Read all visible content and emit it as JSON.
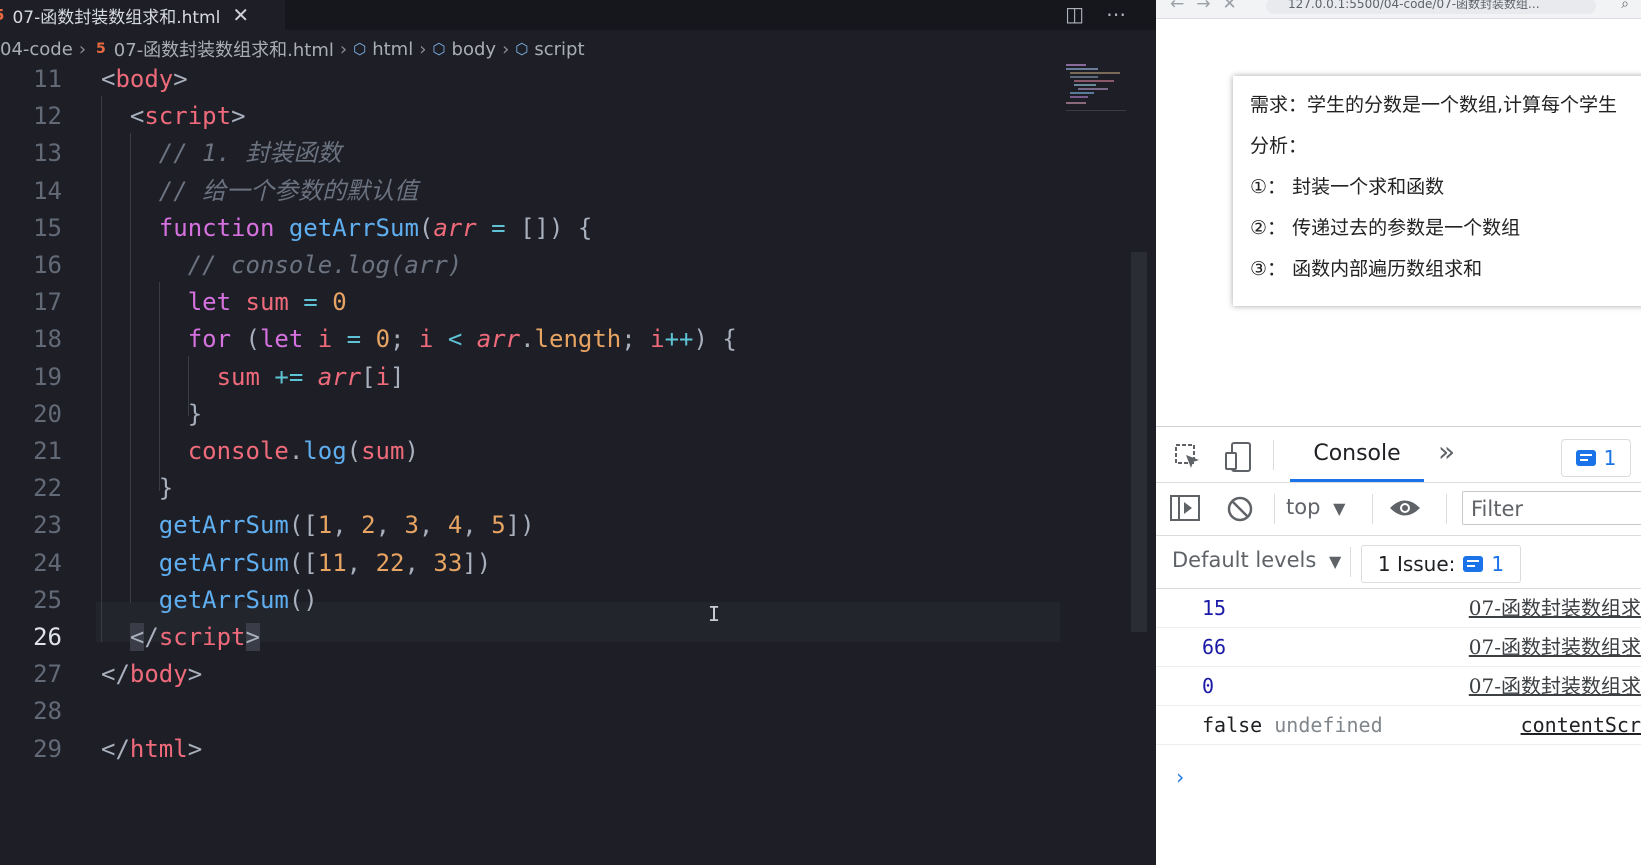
{
  "editor": {
    "tab_title": "07-函数封装数组求和.html",
    "tab_close": "✕",
    "breadcrumb": {
      "folder": "04-code",
      "file": "07-函数封装数组求和.html",
      "node1": "html",
      "node2": "body",
      "node3": "script"
    },
    "lines": [
      {
        "num": "11",
        "tokens": [
          [
            "p",
            "<"
          ],
          [
            "t",
            "body"
          ],
          [
            "p",
            ">"
          ]
        ]
      },
      {
        "num": "12",
        "tokens": [
          [
            "p",
            "  <"
          ],
          [
            "t",
            "script"
          ],
          [
            "p",
            ">"
          ]
        ]
      },
      {
        "num": "13",
        "tokens": [
          [
            "c",
            "    // 1. 封装函数"
          ]
        ]
      },
      {
        "num": "14",
        "tokens": [
          [
            "c",
            "    // 给一个参数的默认值"
          ]
        ]
      },
      {
        "num": "15",
        "tokens": [
          [
            "k",
            "    function "
          ],
          [
            "f",
            "getArrSum"
          ],
          [
            "p",
            "("
          ],
          [
            "it",
            "arr"
          ],
          [
            "o",
            " = "
          ],
          [
            "p",
            "[]) {"
          ]
        ]
      },
      {
        "num": "16",
        "tokens": [
          [
            "c",
            "      // console.log(arr)"
          ]
        ]
      },
      {
        "num": "17",
        "tokens": [
          [
            "k",
            "      let "
          ],
          [
            "v",
            "sum"
          ],
          [
            "o",
            " = "
          ],
          [
            "n",
            "0"
          ]
        ]
      },
      {
        "num": "18",
        "tokens": [
          [
            "k",
            "      for "
          ],
          [
            "p",
            "("
          ],
          [
            "k",
            "let "
          ],
          [
            "v",
            "i"
          ],
          [
            "o",
            " = "
          ],
          [
            "n",
            "0"
          ],
          [
            "p",
            "; "
          ],
          [
            "v",
            "i"
          ],
          [
            "o",
            " < "
          ],
          [
            "it",
            "arr"
          ],
          [
            "p",
            "."
          ],
          [
            "pr",
            "length"
          ],
          [
            "p",
            "; "
          ],
          [
            "v",
            "i"
          ],
          [
            "o",
            "++"
          ],
          [
            "p",
            ") {"
          ]
        ]
      },
      {
        "num": "19",
        "tokens": [
          [
            "v",
            "        sum"
          ],
          [
            "o",
            " += "
          ],
          [
            "it",
            "arr"
          ],
          [
            "p",
            "["
          ],
          [
            "v",
            "i"
          ],
          [
            "p",
            "]"
          ]
        ]
      },
      {
        "num": "20",
        "tokens": [
          [
            "p",
            "      }"
          ]
        ]
      },
      {
        "num": "21",
        "tokens": [
          [
            "v",
            "      console"
          ],
          [
            "p",
            "."
          ],
          [
            "f",
            "log"
          ],
          [
            "p",
            "("
          ],
          [
            "v",
            "sum"
          ],
          [
            "p",
            ")"
          ]
        ]
      },
      {
        "num": "22",
        "tokens": [
          [
            "p",
            "    }"
          ]
        ]
      },
      {
        "num": "23",
        "tokens": [
          [
            "f",
            "    getArrSum"
          ],
          [
            "p",
            "(["
          ],
          [
            "n",
            "1"
          ],
          [
            "p",
            ", "
          ],
          [
            "n",
            "2"
          ],
          [
            "p",
            ", "
          ],
          [
            "n",
            "3"
          ],
          [
            "p",
            ", "
          ],
          [
            "n",
            "4"
          ],
          [
            "p",
            ", "
          ],
          [
            "n",
            "5"
          ],
          [
            "p",
            "])"
          ]
        ]
      },
      {
        "num": "24",
        "tokens": [
          [
            "f",
            "    getArrSum"
          ],
          [
            "p",
            "(["
          ],
          [
            "n",
            "11"
          ],
          [
            "p",
            ", "
          ],
          [
            "n",
            "22"
          ],
          [
            "p",
            ", "
          ],
          [
            "n",
            "33"
          ],
          [
            "p",
            "])"
          ]
        ]
      },
      {
        "num": "25",
        "tokens": [
          [
            "f",
            "    getArrSum"
          ],
          [
            "p",
            "()"
          ]
        ]
      },
      {
        "num": "26",
        "tokens": [
          [
            "p",
            "  "
          ],
          [
            "ps",
            "<"
          ],
          [
            "p",
            "/"
          ],
          [
            "t",
            "script"
          ],
          [
            "ps",
            ">"
          ]
        ]
      },
      {
        "num": "27",
        "tokens": [
          [
            "p",
            "</"
          ],
          [
            "t",
            "body"
          ],
          [
            "p",
            ">"
          ]
        ]
      },
      {
        "num": "28",
        "tokens": []
      },
      {
        "num": "29",
        "tokens": [
          [
            "p",
            "</"
          ],
          [
            "t",
            "html"
          ],
          [
            "p",
            ">"
          ]
        ]
      }
    ]
  },
  "browser": {
    "url": "127.0.0.1:5500/04-code/07-函数封装数组...",
    "card": {
      "requirement": "需求：学生的分数是一个数组,计算每个学生",
      "analysis": "分析：",
      "step1": "①：  封装一个求和函数",
      "step2": "②：  传递过去的参数是一个数组",
      "step3": "③：  函数内部遍历数组求和"
    }
  },
  "devtools": {
    "tab_console": "Console",
    "more": "»",
    "message_count": "1",
    "context": "top",
    "filter_placeholder": "Filter",
    "levels": "Default levels",
    "issues_label": "1 Issue:",
    "issues_count": "1",
    "rows": [
      {
        "value": "15",
        "source": "07-函数封装数组求"
      },
      {
        "value": "66",
        "source": "07-函数封装数组求"
      },
      {
        "value": "0",
        "source": "07-函数封装数组求"
      },
      {
        "value": "false",
        "extra": "undefined",
        "source": "contentScr"
      }
    ],
    "prompt": "›"
  },
  "colors": {
    "editor_bg": "#1e1f26",
    "keyword": "#d671e0",
    "function": "#5faef0",
    "variable": "#ef6a7b",
    "number": "#e7a463",
    "comment": "#6b7280",
    "console_accent": "#1a73e8"
  }
}
